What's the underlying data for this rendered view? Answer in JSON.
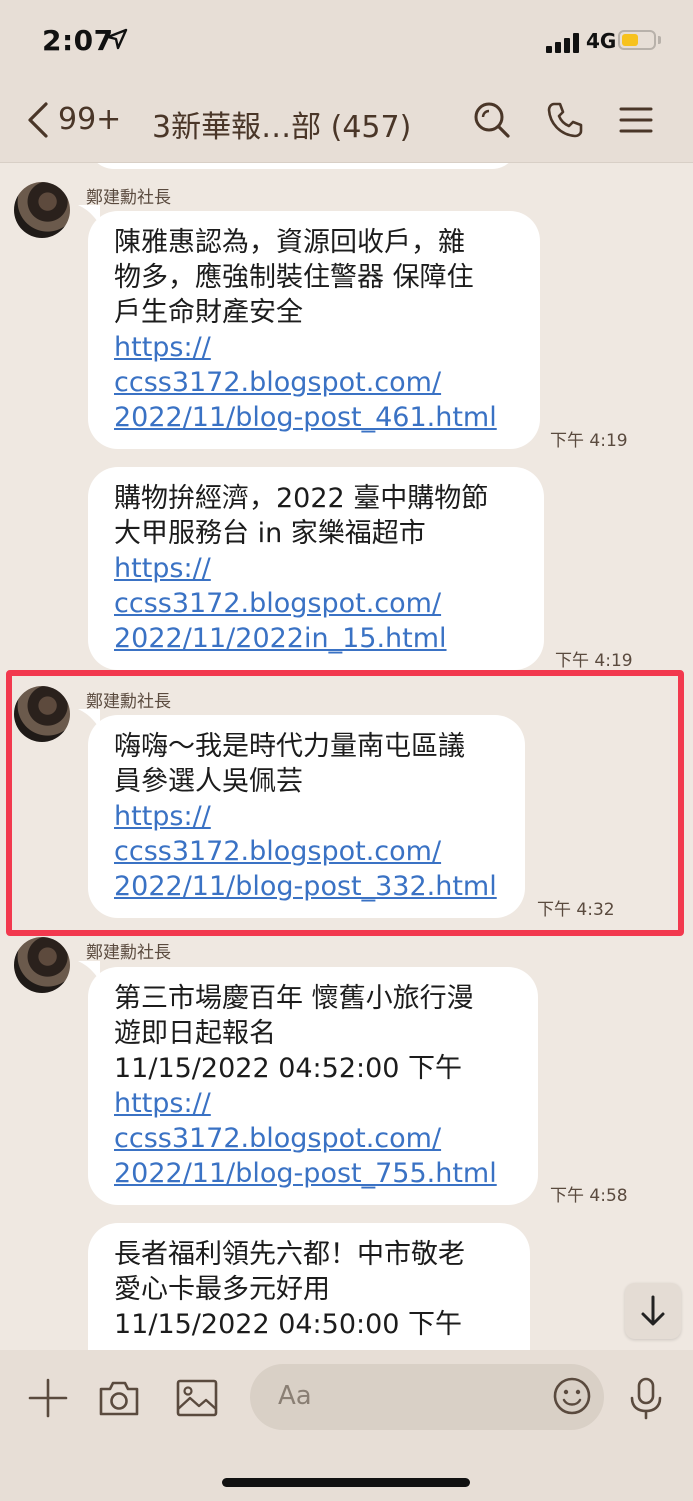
{
  "status_bar": {
    "time": "2:07",
    "network": "4G"
  },
  "header": {
    "back_count": "99+",
    "title": "3新華報…部 (457)"
  },
  "chat": {
    "messages": [
      {
        "sender": "鄭建勳社長",
        "text": "陳雅惠認為，資源回收戶，雜\n物多，應強制裝住警器 保障住\n戶生命財產安全",
        "link": "https://\nccss3172.blogspot.com/\n2022/11/blog-post_461.html",
        "time": "下午 4:19"
      },
      {
        "sender": "",
        "text": "購物拚經濟，2022 臺中購物節\n大甲服務台 in 家樂福超市",
        "link": "https://\nccss3172.blogspot.com/\n2022/11/2022in_15.html",
        "time": "下午 4:19"
      },
      {
        "sender": "鄭建勳社長",
        "text": "嗨嗨～我是時代力量南屯區議\n員參選人吳佩芸",
        "link": "https://\nccss3172.blogspot.com/\n2022/11/blog-post_332.html",
        "time": "下午 4:32"
      },
      {
        "sender": "鄭建勳社長",
        "text": "第三市場慶百年 懷舊小旅行漫\n遊即日起報名\n11/15/2022 04:52:00 下午",
        "link": "https://\nccss3172.blogspot.com/\n2022/11/blog-post_755.html",
        "time": "下午 4:58"
      },
      {
        "sender": "",
        "text": "長者福利領先六都！中市敬老\n愛心卡最多元好用\n11/15/2022 04:50:00 下午",
        "link": "",
        "time": ""
      }
    ]
  },
  "input_bar": {
    "placeholder": "Aa"
  },
  "colors": {
    "background": "#efe8e1",
    "bar": "#e7ded6",
    "link": "#3a72c4",
    "highlight": "#f2394e",
    "header_text": "#4a3628"
  },
  "icons": [
    "location-arrow-icon",
    "signal-icon",
    "battery-icon",
    "chevron-left-icon",
    "search-icon",
    "phone-icon",
    "menu-icon",
    "plus-icon",
    "camera-icon",
    "image-icon",
    "emoji-icon",
    "microphone-icon",
    "arrow-down-icon"
  ]
}
